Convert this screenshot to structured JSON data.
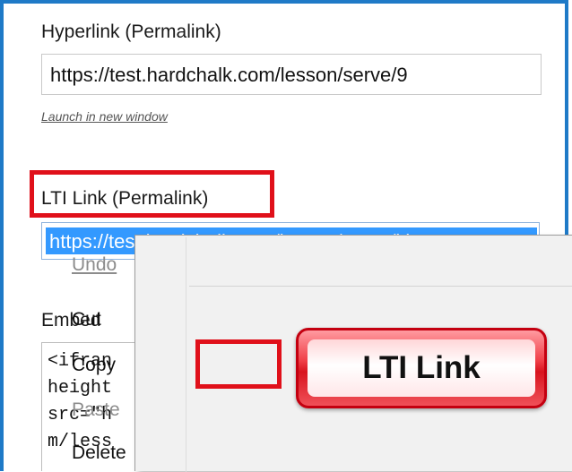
{
  "hyperlink": {
    "label": "Hyperlink (Permalink)",
    "value": "https://test.hardchalk.com/lesson/serve/9",
    "launch_link": "Launch in new window"
  },
  "lti": {
    "label": "LTI Link (Permalink)",
    "value": "https://test.hardchalk.com/lesson/serve/lti"
  },
  "embed": {
    "label": "Embed",
    "code_lines": [
      "<ifran",
      "height",
      "src=\"h",
      "m/less"
    ]
  },
  "context_menu": {
    "items": [
      {
        "label": "Undo",
        "enabled": false
      },
      {
        "label": "Cut",
        "enabled": true
      },
      {
        "label": "Copy",
        "enabled": true
      },
      {
        "label": "Paste",
        "enabled": false
      },
      {
        "label": "Delete",
        "enabled": true
      }
    ]
  },
  "callout": {
    "text": "LTI Link"
  },
  "colors": {
    "frame_border": "#1f7ac7",
    "highlight_red": "#e0101a",
    "selection_blue": "#3399ff"
  }
}
